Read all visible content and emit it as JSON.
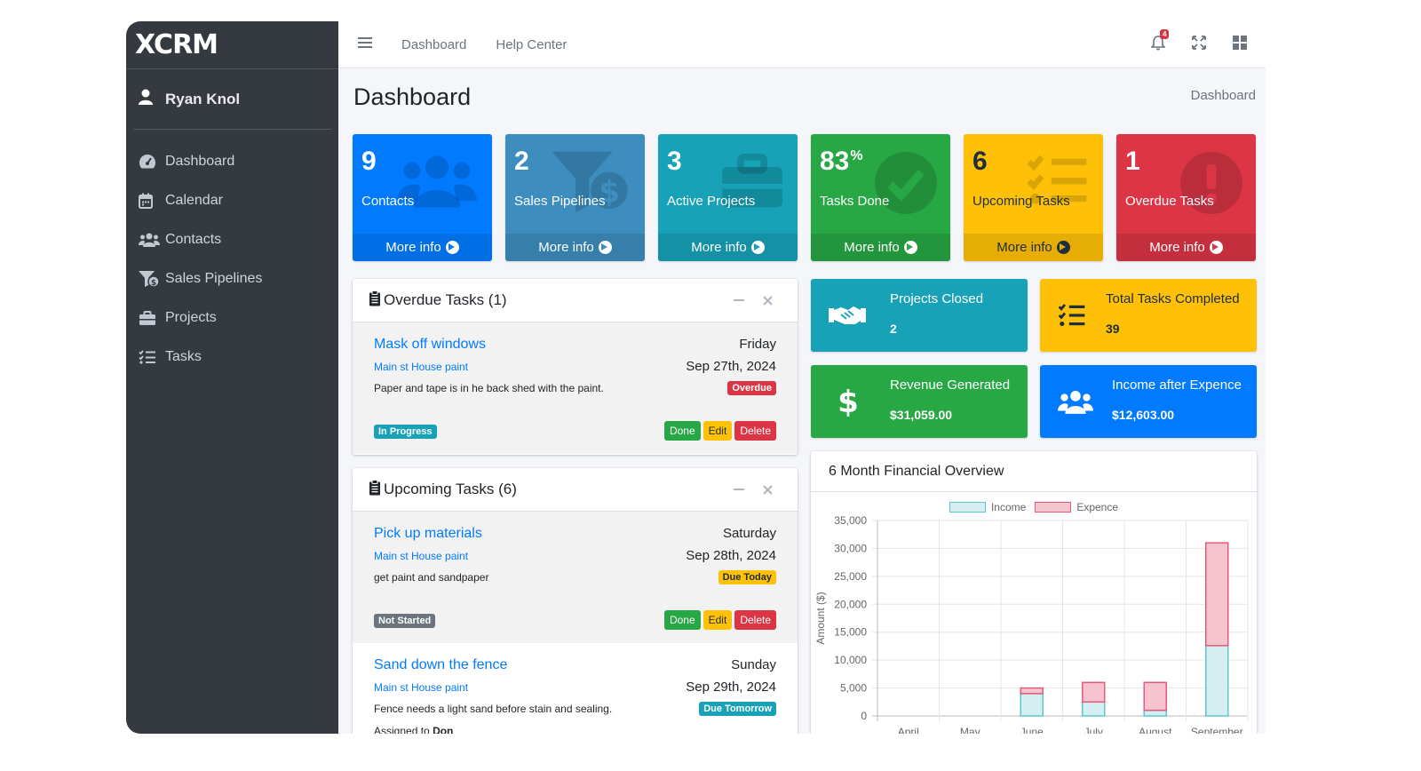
{
  "brand": {
    "logo_text": "XCRM"
  },
  "user": {
    "name": "Ryan Knol"
  },
  "sidebar": {
    "items": [
      {
        "label": "Dashboard",
        "icon": "gauge-icon"
      },
      {
        "label": "Calendar",
        "icon": "calendar-icon"
      },
      {
        "label": "Contacts",
        "icon": "users-icon"
      },
      {
        "label": "Sales Pipelines",
        "icon": "funnel-dollar-icon"
      },
      {
        "label": "Projects",
        "icon": "briefcase-icon"
      },
      {
        "label": "Tasks",
        "icon": "tasks-icon"
      }
    ]
  },
  "topbar": {
    "links": [
      "Dashboard",
      "Help Center"
    ],
    "notification_count": "4"
  },
  "page": {
    "title": "Dashboard",
    "breadcrumb": "Dashboard"
  },
  "small_boxes": [
    {
      "value": "9",
      "label": "Contacts",
      "more": "More info",
      "color": "#007bff",
      "icon": "users-icon"
    },
    {
      "value": "2",
      "label": "Sales Pipelines",
      "more": "More info",
      "color": "#3d8ebf",
      "icon": "funnel-dollar-icon"
    },
    {
      "value": "3",
      "label": "Active Projects",
      "more": "More info",
      "color": "#17a2b8",
      "icon": "briefcase-icon"
    },
    {
      "value": "83",
      "unit": "%",
      "label": "Tasks Done",
      "more": "More info",
      "color": "#28a745",
      "icon": "check-circle-icon"
    },
    {
      "value": "6",
      "label": "Upcoming Tasks",
      "more": "More info",
      "color": "#ffc107",
      "icon": "tasks-icon"
    },
    {
      "value": "1",
      "label": "Overdue Tasks",
      "more": "More info",
      "color": "#dc3545",
      "icon": "exclamation-circle-icon"
    }
  ],
  "overdue": {
    "title": "Overdue Tasks (1)",
    "tasks": [
      {
        "title": "Mask off windows",
        "project": "Main st House paint",
        "description": "Paper and tape is in he back shed with the paint.",
        "day": "Friday",
        "date": "Sep 27th, 2024",
        "due_badge": "Overdue",
        "status": "In Progress"
      }
    ]
  },
  "upcoming": {
    "title": "Upcoming Tasks (6)",
    "tasks": [
      {
        "title": "Pick up materials",
        "project": "Main st House paint",
        "description": "get paint and sandpaper",
        "day": "Saturday",
        "date": "Sep 28th, 2024",
        "due_badge": "Due Today",
        "status": "Not Started"
      },
      {
        "title": "Sand down the fence",
        "project": "Main st House paint",
        "description": "Fence needs a light sand before stain and sealing.",
        "day": "Sunday",
        "date": "Sep 29th, 2024",
        "due_badge": "Due Tomorrow",
        "assigned_label": "Assigned to",
        "assigned_name": "Don"
      }
    ]
  },
  "buttons": {
    "done": "Done",
    "edit": "Edit",
    "delete": "Delete"
  },
  "info_boxes": [
    {
      "label": "Projects Closed",
      "value": "2",
      "color": "#17a2b8",
      "icon": "handshake-icon"
    },
    {
      "label": "Total Tasks Completed",
      "value": "39",
      "color": "#ffc107",
      "icon": "list-check-icon"
    },
    {
      "label": "Revenue Generated",
      "value": "$31,059.00",
      "color": "#28a745",
      "icon": "dollar-icon"
    },
    {
      "label": "Income after Expence",
      "value": "$12,603.00",
      "color": "#007bff",
      "icon": "users-icon"
    }
  ],
  "chart_card": {
    "title": "6 Month Financial Overview"
  },
  "chart_data": {
    "type": "bar",
    "stacked": true,
    "categories": [
      "April",
      "May",
      "June",
      "July",
      "August",
      "September"
    ],
    "series": [
      {
        "name": "Income",
        "values": [
          0,
          0,
          4000,
          2500,
          1000,
          12600
        ],
        "fill": "#d4eef2",
        "stroke": "#5ec6cf"
      },
      {
        "name": "Expence",
        "values": [
          0,
          0,
          1000,
          3500,
          5000,
          18400
        ],
        "fill": "#f5c4cf",
        "stroke": "#e45a78"
      }
    ],
    "ylabel": "Amount ($)",
    "ylim": [
      0,
      35000
    ],
    "yticks": [
      "35,000",
      "30,000",
      "25,000",
      "20,000",
      "15,000",
      "10,000",
      "5,000",
      "0"
    ],
    "legend": "top",
    "grid": true
  }
}
